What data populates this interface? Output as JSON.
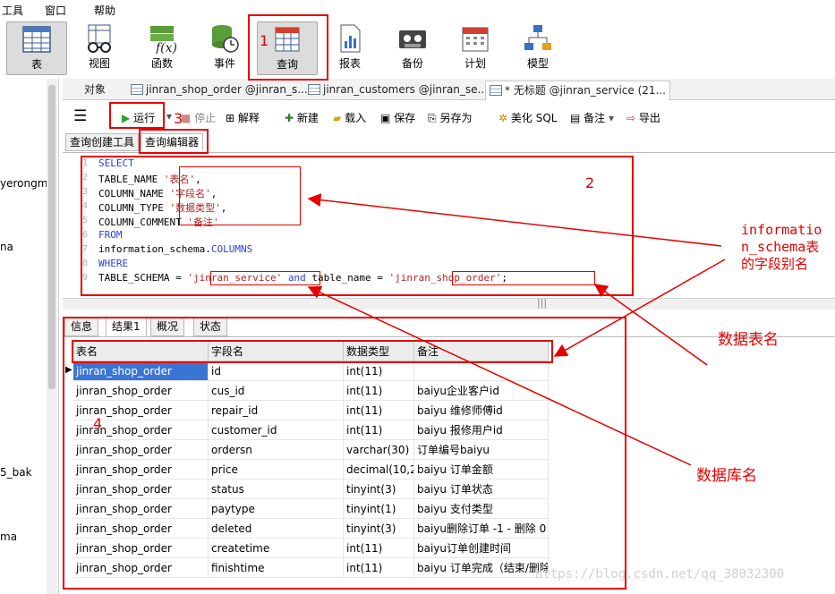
{
  "menu": [
    "工具",
    "窗口",
    "帮助"
  ],
  "toolbar": [
    {
      "label": "表",
      "icon": "table-icon"
    },
    {
      "label": "视图",
      "icon": "view-glasses-icon"
    },
    {
      "label": "函数",
      "icon": "function-fx-icon"
    },
    {
      "label": "事件",
      "icon": "event-clock-icon"
    },
    {
      "label": "查询",
      "icon": "query-table-icon"
    },
    {
      "label": "报表",
      "icon": "report-chart-icon"
    },
    {
      "label": "备份",
      "icon": "backup-tape-icon"
    },
    {
      "label": "计划",
      "icon": "schedule-calendar-icon"
    },
    {
      "label": "模型",
      "icon": "model-diagram-icon"
    }
  ],
  "sidebar": [
    "yerongm",
    "na",
    "5_bak",
    "ma"
  ],
  "doc_tabs": [
    "对象",
    "jinran_shop_order @jinran_s...",
    "jinran_customers @jinran_se...",
    "* 无标题 @jinran_service (21..."
  ],
  "sub_toolbar": {
    "run": "运行",
    "stop": "停止",
    "explain": "解释",
    "new": "新建",
    "load": "载入",
    "save": "保存",
    "save_as": "另存为",
    "beautify": "美化 SQL",
    "comment": "备注",
    "export": "导出"
  },
  "editor_tabs": [
    "查询创建工具",
    "查询编辑器"
  ],
  "sql_lines": [
    {
      "n": "1",
      "parts": [
        [
          "kw",
          "SELECT"
        ]
      ]
    },
    {
      "n": "2",
      "parts": [
        [
          "",
          "TABLE_NAME "
        ],
        [
          "str",
          "'表名'"
        ],
        [
          "",
          ","
        ]
      ]
    },
    {
      "n": "3",
      "parts": [
        [
          "",
          "COLUMN_NAME "
        ],
        [
          "str",
          "'字段名'"
        ],
        [
          "",
          ","
        ]
      ]
    },
    {
      "n": "4",
      "parts": [
        [
          "",
          "COLUMN_TYPE "
        ],
        [
          "str",
          "'数据类型'"
        ],
        [
          "",
          ","
        ]
      ]
    },
    {
      "n": "5",
      "parts": [
        [
          "",
          "COLUMN_COMMENT "
        ],
        [
          "str",
          "'备注'"
        ]
      ]
    },
    {
      "n": "6",
      "parts": [
        [
          "kw",
          "FROM"
        ]
      ]
    },
    {
      "n": "7",
      "parts": [
        [
          "",
          "information_schema."
        ],
        [
          "kw",
          "COLUMNS"
        ]
      ]
    },
    {
      "n": "8",
      "parts": [
        [
          "kw",
          "WHERE"
        ]
      ]
    },
    {
      "n": "9",
      "parts": [
        [
          "",
          "TABLE_SCHEMA = "
        ],
        [
          "str",
          "'jinran_service'"
        ],
        [
          "",
          " "
        ],
        [
          "kw",
          "and"
        ],
        [
          "",
          " table_name = "
        ],
        [
          "str",
          "'jinran_shop_order'"
        ],
        [
          "",
          ";"
        ]
      ]
    }
  ],
  "result_tabs": [
    "信息",
    "结果1",
    "概况",
    "状态"
  ],
  "grid": {
    "headers": [
      "表名",
      "字段名",
      "数据类型",
      "备注"
    ],
    "rows": [
      [
        "jinran_shop_order",
        "id",
        "int(11)",
        ""
      ],
      [
        "jinran_shop_order",
        "cus_id",
        "int(11)",
        "baiyu企业客户id"
      ],
      [
        "jinran_shop_order",
        "repair_id",
        "int(11)",
        "baiyu 维修师傅id"
      ],
      [
        "jinran_shop_order",
        "customer_id",
        "int(11)",
        "baiyu 报修用户id"
      ],
      [
        "jinran_shop_order",
        "ordersn",
        "varchar(30)",
        "订单编号baiyu"
      ],
      [
        "jinran_shop_order",
        "price",
        "decimal(10,2)",
        "baiyu 订单金额"
      ],
      [
        "jinran_shop_order",
        "status",
        "tinyint(3)",
        "baiyu 订单状态"
      ],
      [
        "jinran_shop_order",
        "paytype",
        "tinyint(1)",
        "baiyu 支付类型"
      ],
      [
        "jinran_shop_order",
        "deleted",
        "tinyint(3)",
        "baiyu删除订单 -1 - 删除   0"
      ],
      [
        "jinran_shop_order",
        "createtime",
        "int(11)",
        "baiyu订单创建时间"
      ],
      [
        "jinran_shop_order",
        "finishtime",
        "int(11)",
        "baiyu 订单完成（结束/删除"
      ]
    ]
  },
  "annotations": {
    "num1": "1",
    "num2": "2",
    "num3": "3",
    "num4": "4",
    "alias_note_line1": "informatio",
    "alias_note_line2": "n_schema表",
    "alias_note_line3": "的字段别名",
    "table_name_note": "数据表名",
    "db_name_note": "数据库名"
  },
  "watermark": "https://blog.csdn.net/qq_38032300",
  "colors": {
    "annotation": "#e60000",
    "keyword": "#2b3fd8",
    "string": "#b22222",
    "selection": "#3b75d4"
  }
}
